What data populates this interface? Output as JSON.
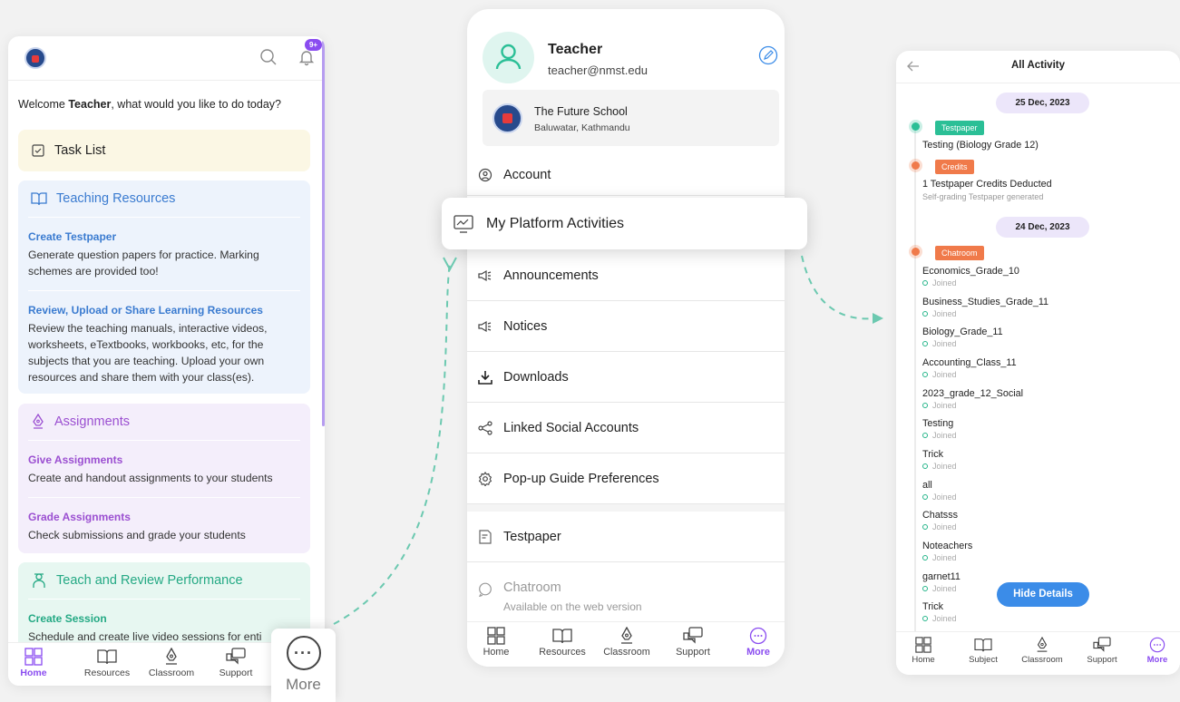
{
  "screen1": {
    "notification_badge": "9+",
    "welcome_prefix": "Welcome ",
    "welcome_name": "Teacher",
    "welcome_suffix": ", what would you like to do today?",
    "task_list": "Task List",
    "teaching": {
      "title": "Teaching Resources",
      "items": [
        {
          "title": "Create Testpaper",
          "desc": "Generate question papers for practice. Marking schemes are provided too!"
        },
        {
          "title": "Review, Upload or Share Learning Resources",
          "desc": "Review the teaching manuals, interactive videos, worksheets, eTextbooks, workbooks, etc, for the subjects that you are teaching. Upload your own resources and share them with your class(es)."
        }
      ]
    },
    "assignments": {
      "title": "Assignments",
      "items": [
        {
          "title": "Give Assignments",
          "desc": "Create and handout assignments to your students"
        },
        {
          "title": "Grade Assignments",
          "desc": "Check submissions and grade your students"
        }
      ]
    },
    "performance": {
      "title": "Teach and Review Performance",
      "items": [
        {
          "title": "Create Session",
          "desc": "Schedule and create live video sessions for enti"
        }
      ]
    },
    "nav": [
      "Home",
      "Resources",
      "Classroom",
      "Support"
    ],
    "more_popup": "More"
  },
  "screen2": {
    "name": "Teacher",
    "email": "teacher@nmst.edu",
    "school_name": "The Future School",
    "school_location": "Baluwatar, Kathmandu",
    "menu": {
      "account": "Account",
      "platform_activities": "My Platform Activities",
      "announcements": "Announcements",
      "notices": "Notices",
      "downloads": "Downloads",
      "linked_social": "Linked Social Accounts",
      "popup_guide": "Pop-up Guide Preferences",
      "testpaper": "Testpaper",
      "chatroom": "Chatroom",
      "chatroom_sub": "Available on the web version"
    },
    "nav": [
      "Home",
      "Resources",
      "Classroom",
      "Support",
      "More"
    ]
  },
  "screen3": {
    "title": "All Activity",
    "date1": "25 Dec, 2023",
    "tag_testpaper": "Testpaper",
    "testpaper_title": "Testing (Biology Grade 12)",
    "tag_credits": "Credits",
    "credits_title": "1 Testpaper Credits Deducted",
    "credits_sub": "Self-grading Testpaper generated",
    "date2": "24 Dec, 2023",
    "tag_chatroom": "Chatroom",
    "joined_label": "Joined",
    "chatrooms": [
      "Economics_Grade_10",
      "Business_Studies_Grade_11",
      "Biology_Grade_11",
      "Accounting_Class_11",
      "2023_grade_12_Social",
      "Testing",
      "Trick",
      "all",
      "Chatsss",
      "Noteachers",
      "garnet11",
      "Trick"
    ],
    "hide_details": "Hide Details",
    "nav": [
      "Home",
      "Subject",
      "Classroom",
      "Support",
      "More"
    ]
  },
  "colors": {
    "accent_purple": "#8a4cf0",
    "teal": "#2bbf96",
    "orange": "#f07a4a",
    "blue": "#3b8ce8"
  }
}
